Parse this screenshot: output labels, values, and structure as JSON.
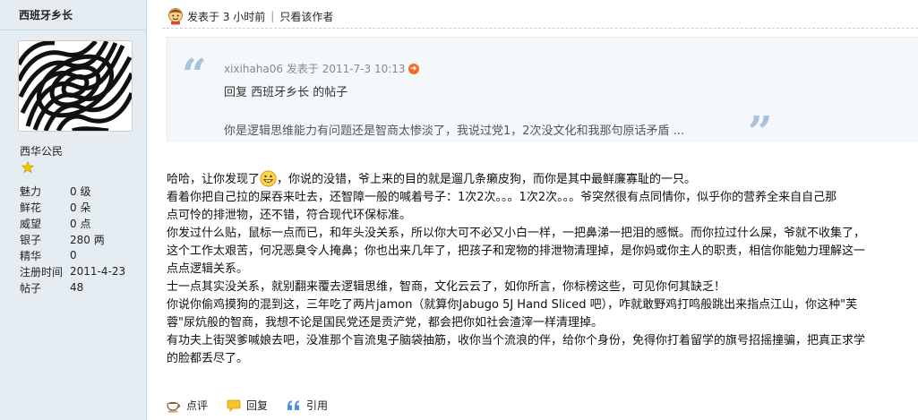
{
  "author": {
    "name": "西班牙乡长",
    "group": "西华公民",
    "stats": [
      {
        "label": "魅力",
        "value": "0 级"
      },
      {
        "label": "鲜花",
        "value": "0 朵"
      },
      {
        "label": "威望",
        "value": "0 点"
      },
      {
        "label": "银子",
        "value": "280 两"
      },
      {
        "label": "精华",
        "value": "0"
      },
      {
        "label": "注册时间",
        "value": "2011-4-23"
      },
      {
        "label": "帖子",
        "value": "48"
      }
    ]
  },
  "topbar": {
    "posted": "发表于 3 小时前",
    "separator": "|",
    "only_author": "只看该作者"
  },
  "quote": {
    "author_line": "xixihaha06 发表于 2011-7-3 10:13",
    "reply_to": "回复 西班牙乡长 的帖子",
    "text": "你是逻辑思维能力有问题还是智商太惨淡了，我说过党1，2次没文化和我那句原话矛盾 ..."
  },
  "content": {
    "line1_a": "哈哈，让你发现了",
    "line1_b": "，你说的没错，爷上来的目的就是遛几条癞皮狗，而你是其中最鲜廉寡耻的一只。",
    "lines": [
      "看着你把自己拉的屎吞来吐去，还智障一般的喊着号子：1次2次。。。1次2次。。。爷突然很有点同情你，似乎你的营养全来自自己那",
      "点可怜的排泄物，还不错，符合现代环保标准。",
      "你发过什么贴，鼠标一点而已，和年头没关系，所以你大可不必又小白一样，一把鼻涕一把泪的感慨。而你拉过什么屎，爷就不收集了，",
      "这个工作太艰苦，何况恶臭令人掩鼻；你也出来几年了，把孩子和宠物的排泄物清理掉，是你妈或你主人的职责，相信你能勉力理解这一",
      "点点逻辑关系。",
      "士一点其实没关系，就别翻来覆去逻辑思维，智商，文化云云了，如你所言，你标榜这些，可见你何其缺乏！",
      "你说你偷鸡摸狗的混到这，三年吃了两片jamon（就算你Jabugo 5J Hand Sliced 吧），咋就敢野鸡打鸣般跳出来指点江山，你这种\"芙",
      "蓉\"尿炕般的智商，我想不论是国民党还是贡浐党，都会把你如社会渣滓一样清理掉。",
      "有功夫上街哭爹喊娘去吧，没准那个盲流鬼子脑袋抽筋，收你当个流浪的伴，给你个身份，免得你打着留学的旗号招摇撞骗，把真正求学",
      "的脸都丢尽了。"
    ]
  },
  "actions": {
    "rate": "点评",
    "reply": "回复",
    "quote": "引用"
  },
  "colors": {
    "sidebar_bg": "#e5edf2",
    "quote_bg": "#f5f8fa",
    "quote_mark": "#a8c4dc"
  }
}
